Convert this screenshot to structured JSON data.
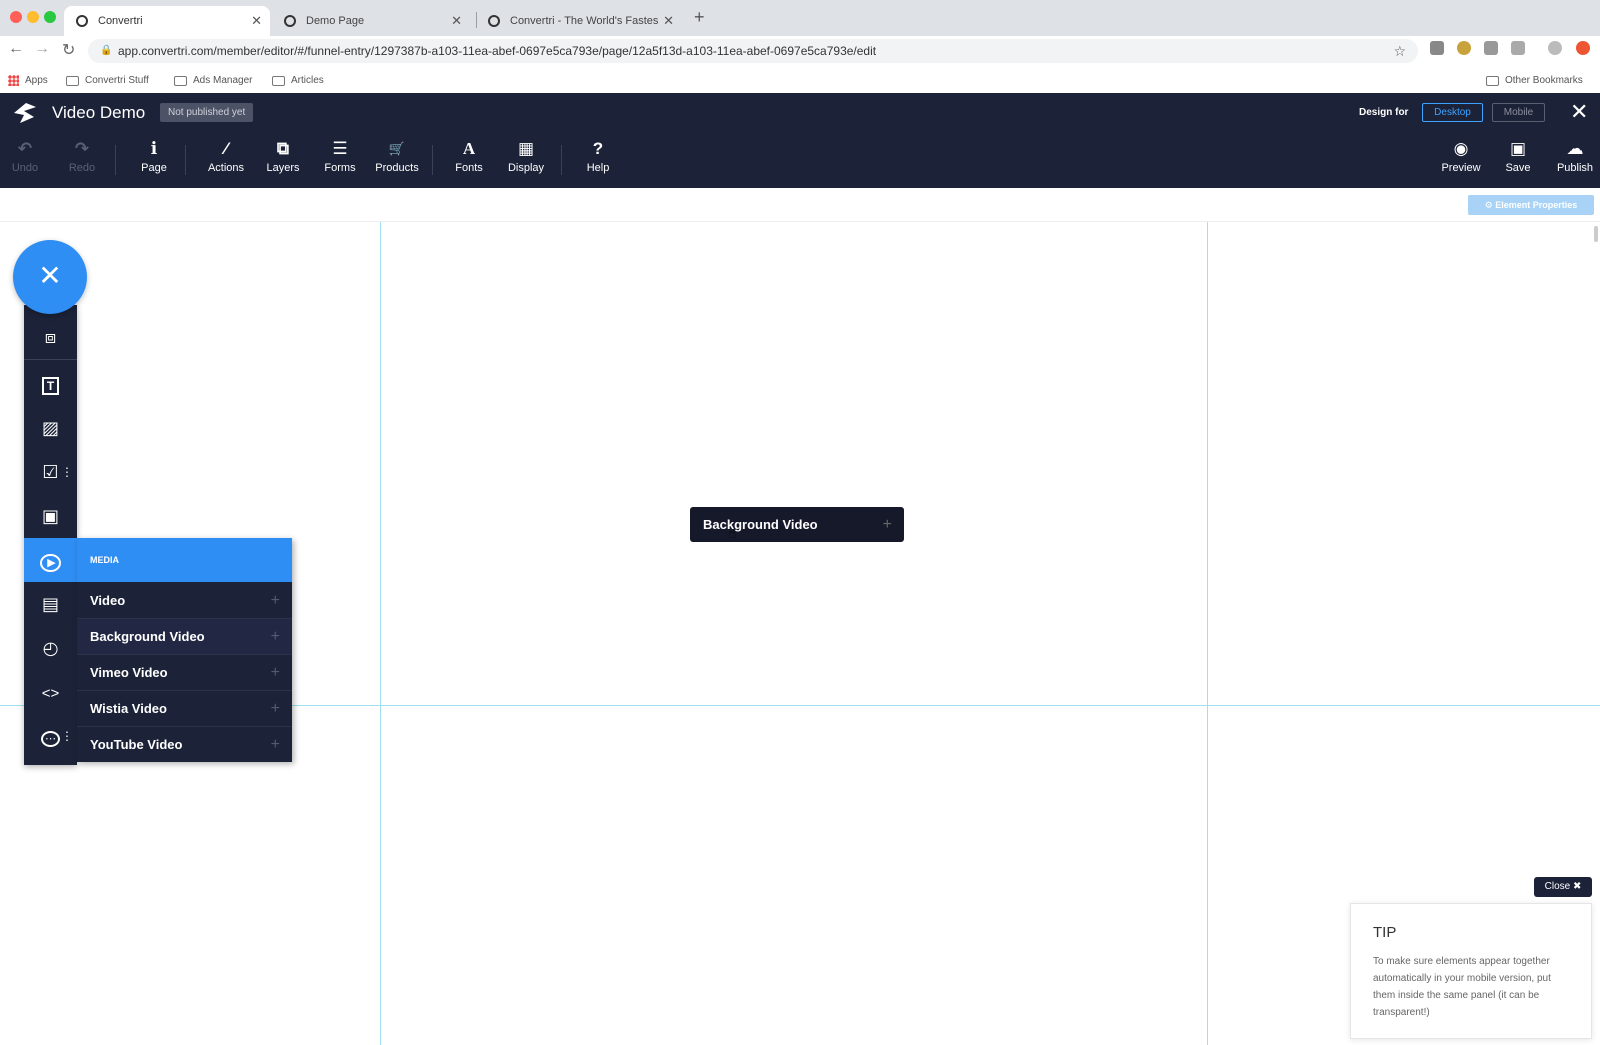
{
  "browser": {
    "tabs": [
      {
        "title": "Convertri"
      },
      {
        "title": "Demo Page"
      },
      {
        "title": "Convertri - The World's Fastes"
      }
    ],
    "url": "app.convertri.com/member/editor/#/funnel-entry/1297387b-a103-11ea-abef-0697e5ca793e/page/12a5f13d-a103-11ea-abef-0697e5ca793e/edit",
    "bookmarks": [
      "Apps",
      "Convertri Stuff",
      "Ads Manager",
      "Articles"
    ],
    "other_bookmarks": "Other Bookmarks"
  },
  "app": {
    "title": "Video Demo",
    "publish_status": "Not published yet",
    "design_for_label": "Design for",
    "desktop_label": "Desktop",
    "mobile_label": "Mobile",
    "toolbar_left": [
      {
        "label": "Undo",
        "icon": "undo-icon",
        "glyph": "↶"
      },
      {
        "label": "Redo",
        "icon": "redo-icon",
        "glyph": "↷"
      },
      {
        "label": "Page",
        "icon": "info-icon",
        "glyph": "ℹ"
      },
      {
        "label": "Actions",
        "icon": "magic-wand-icon",
        "glyph": "⁄"
      },
      {
        "label": "Layers",
        "icon": "layers-icon",
        "glyph": "⧉"
      },
      {
        "label": "Forms",
        "icon": "list-icon",
        "glyph": "☰"
      },
      {
        "label": "Products",
        "icon": "cart-icon",
        "glyph": "🛒"
      },
      {
        "label": "Fonts",
        "icon": "font-icon",
        "glyph": "A"
      },
      {
        "label": "Display",
        "icon": "grid-icon",
        "glyph": "▦"
      },
      {
        "label": "Help",
        "icon": "help-icon",
        "glyph": "?"
      }
    ],
    "toolbar_right": [
      {
        "label": "Preview",
        "icon": "eye-icon",
        "glyph": "◉"
      },
      {
        "label": "Save",
        "icon": "save-icon",
        "glyph": "▣"
      },
      {
        "label": "Publish",
        "icon": "cloud-upload-icon",
        "glyph": "☁"
      }
    ],
    "element_properties": "⚙ Element Properties"
  },
  "sidebar": {
    "items": [
      {
        "icon": "puzzle-icon",
        "glyph": "⧈"
      },
      {
        "icon": "text-icon",
        "glyph": "T"
      },
      {
        "icon": "image-icon",
        "glyph": "▨"
      },
      {
        "icon": "checkbox-icon",
        "glyph": "☑"
      },
      {
        "icon": "panel-icon",
        "glyph": "▣"
      },
      {
        "icon": "play-icon",
        "glyph": "▶"
      },
      {
        "icon": "form-icon",
        "glyph": "▤"
      },
      {
        "icon": "timer-icon",
        "glyph": "◴"
      },
      {
        "icon": "code-icon",
        "glyph": "<>"
      },
      {
        "icon": "more-icon",
        "glyph": "⋯"
      }
    ]
  },
  "media_menu": {
    "header": "MEDIA",
    "items": [
      "Video",
      "Background Video",
      "Vimeo Video",
      "Wistia Video",
      "YouTube Video"
    ]
  },
  "drag_chip": {
    "label": "Background Video"
  },
  "tip": {
    "close_label": "Close ✖",
    "title": "TIP",
    "text": "To make sure elements appear together automatically in your mobile version, put them inside the same panel (it can be transparent!)"
  },
  "colors": {
    "accent": "#2f8ef4",
    "header_bg": "#1c2238"
  }
}
